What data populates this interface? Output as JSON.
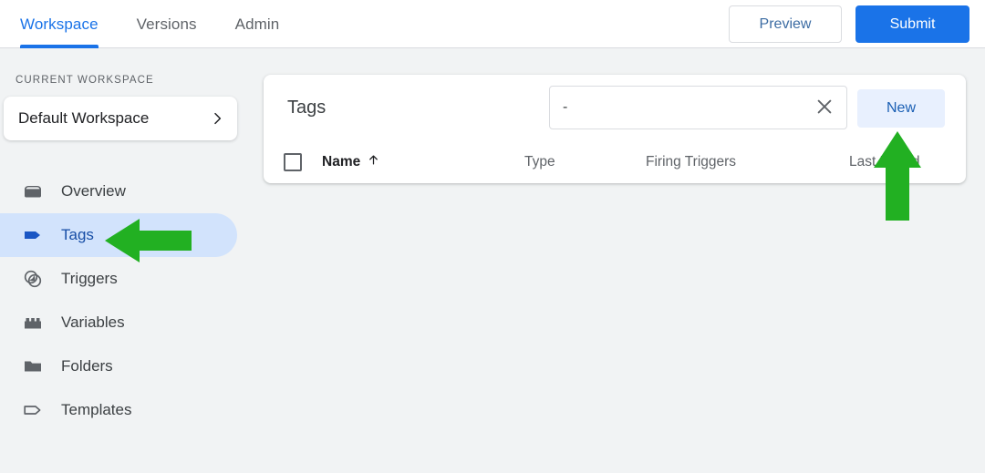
{
  "header": {
    "tabs": [
      {
        "label": "Workspace",
        "active": true
      },
      {
        "label": "Versions",
        "active": false
      },
      {
        "label": "Admin",
        "active": false
      }
    ],
    "preview_label": "Preview",
    "submit_label": "Submit",
    "accent_color": "#1a73e8"
  },
  "sidebar": {
    "workspace_section_label": "CURRENT WORKSPACE",
    "workspace_name": "Default Workspace",
    "items": [
      {
        "label": "Overview",
        "icon": "overview-icon",
        "active": false
      },
      {
        "label": "Tags",
        "icon": "tag-icon",
        "active": true
      },
      {
        "label": "Triggers",
        "icon": "triggers-icon",
        "active": false
      },
      {
        "label": "Variables",
        "icon": "variables-icon",
        "active": false
      },
      {
        "label": "Folders",
        "icon": "folder-icon",
        "active": false
      },
      {
        "label": "Templates",
        "icon": "template-icon",
        "active": false
      }
    ],
    "active_highlight_color": "#d2e3fc"
  },
  "main": {
    "card_title": "Tags",
    "search": {
      "value": "-",
      "placeholder": "",
      "clear_icon": "close-icon"
    },
    "new_button_label": "New",
    "table": {
      "columns": [
        {
          "label": "Name",
          "sort": "ascending",
          "sort_icon": "arrow-up-icon"
        },
        {
          "label": "Type"
        },
        {
          "label": "Firing Triggers"
        },
        {
          "label": "Last Edited"
        }
      ],
      "rows": [],
      "select_all_checked": false
    }
  },
  "annotations": {
    "color": "#22b022",
    "arrows": [
      {
        "name": "arrow-pointing-to-tags",
        "direction": "left"
      },
      {
        "name": "arrow-pointing-to-new-button",
        "direction": "up"
      }
    ]
  }
}
